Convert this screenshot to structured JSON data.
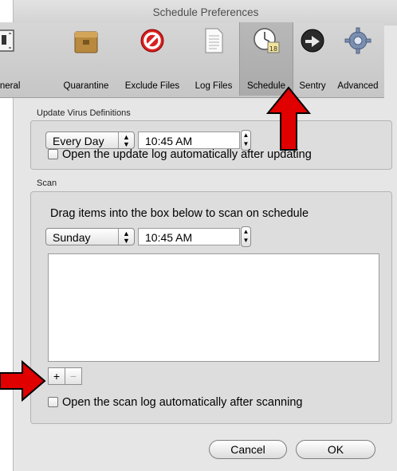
{
  "window": {
    "title": "Schedule Preferences"
  },
  "toolbar": {
    "items": [
      {
        "label": "General",
        "icon": "switch-icon"
      },
      {
        "label": "Quarantine",
        "icon": "box-icon"
      },
      {
        "label": "Exclude Files",
        "icon": "no-entry-icon"
      },
      {
        "label": "Log Files",
        "icon": "document-icon"
      },
      {
        "label": "Schedule",
        "icon": "clock-calendar-icon",
        "selected": true,
        "calendar_day": "18"
      },
      {
        "label": "Sentry",
        "icon": "sentry-icon"
      },
      {
        "label": "Advanced",
        "icon": "gear-icon"
      }
    ]
  },
  "update_section": {
    "label": "Update Virus Definitions",
    "frequency": "Every Day",
    "time": "10:45 AM",
    "checkbox_label": "Open the update log automatically after updating"
  },
  "scan_section": {
    "label": "Scan",
    "instruction": "Drag items into the box below to scan on schedule",
    "day": "Sunday",
    "time": "10:45 AM",
    "add_label": "+",
    "remove_label": "−",
    "checkbox_label": "Open the scan log automatically after scanning"
  },
  "buttons": {
    "cancel": "Cancel",
    "ok": "OK"
  },
  "colors": {
    "arrow": "#e00000"
  }
}
